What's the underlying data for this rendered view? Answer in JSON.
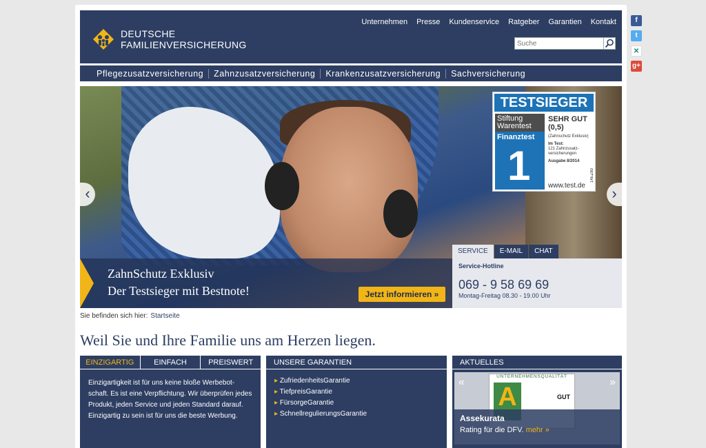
{
  "brand": {
    "line1": "DEUTSCHE",
    "line2": "FAMILIENVERSICHERUNG"
  },
  "topnav": [
    "Unternehmen",
    "Presse",
    "Kundenservice",
    "Ratgeber",
    "Garantien",
    "Kontakt"
  ],
  "search": {
    "placeholder": "Suche"
  },
  "mainnav": [
    "Pflegezusatzversicherung",
    "Zahnzusatzversicherung",
    "Krankenzusatzversicherung",
    "Sachversicherung"
  ],
  "hero": {
    "badge": {
      "top": "TESTSIEGER",
      "stiftung": "Stiftung Warentest",
      "finanztest": "Finanztest",
      "grade": "SEHR GUT (0,5)",
      "product": "(Zahnschutz Exklusiv)",
      "test_line1": "Im Test:",
      "test_line2": "121 Zahnzusatz-versicherungen",
      "issue": "Ausgabe 8/2014",
      "web": "www.test.de",
      "id": "14EZ80"
    },
    "promo_line1": "ZahnSchutz Exklusiv",
    "promo_line2": "Der Testsieger mit Bestnote!",
    "promo_button": "Jetzt informieren »"
  },
  "service": {
    "tabs": [
      "SERVICE",
      "E-MAIL",
      "CHAT"
    ],
    "heading": "Service-Hotline",
    "phone": "069 - 9 58 69 69",
    "hours": "Montag-Freitag 08.30 - 19.00 Uhr"
  },
  "breadcrumb": {
    "label": "Sie befinden sich hier:",
    "link": "Startseite"
  },
  "headline": "Weil Sie und Ihre Familie uns am Herzen liegen.",
  "box1": {
    "tabs": [
      "EINZIGARTIG",
      "EINFACH",
      "PREISWERT"
    ],
    "text": "Einzigartigkeit ist für uns keine bloße Werbebot-schaft. Es ist eine Verpflichtung. Wir überprüfen jedes Produkt, jeden Service und jeden Standard darauf. Einzigartig zu sein ist für uns die beste Werbung."
  },
  "box2": {
    "heading": "UNSERE GARANTIEN",
    "items": [
      "ZufriedenheitsGarantie",
      "TiefpreisGarantie",
      "FürsorgeGarantie",
      "SchnellregulierungsGarantie"
    ]
  },
  "box3": {
    "heading": "AKTUELLES",
    "cert_header": "UNTERNEHMENSQUALITÄT",
    "cert_grade": "GUT",
    "news_title": "Assekurata",
    "news_text": "Rating für die DFV.",
    "news_more": "mehr »"
  },
  "colors": {
    "navy": "#2d3e62",
    "accent": "#f2b517"
  },
  "social": [
    "facebook-icon",
    "twitter-icon",
    "xing-icon",
    "googleplus-icon"
  ]
}
